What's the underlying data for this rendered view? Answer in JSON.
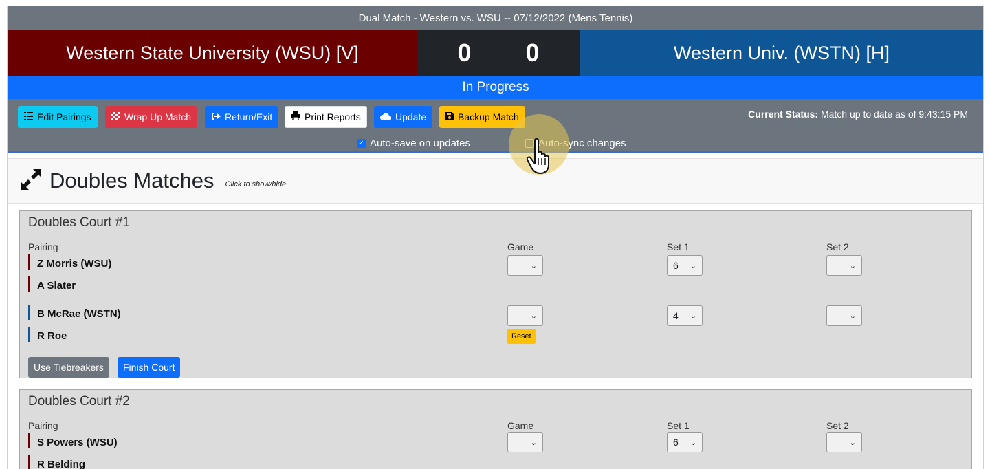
{
  "header": {
    "title": "Dual Match - Western vs. WSU -- 07/12/2022 (Mens Tennis)"
  },
  "scoreboard": {
    "away_team": "Western State University (WSU) [V]",
    "away_score": "0",
    "home_score": "0",
    "home_team": "Western Univ. (WSTN) [H]",
    "away_color": "#6a0000",
    "home_color": "#0e5696"
  },
  "status_bar": {
    "text": "In Progress"
  },
  "toolbar": {
    "buttons": [
      {
        "label": "Edit Pairings",
        "icon": "list-icon"
      },
      {
        "label": "Wrap Up Match",
        "icon": "checkered-flag-icon"
      },
      {
        "label": "Return/Exit",
        "icon": "sign-out-icon"
      },
      {
        "label": "Print Reports",
        "icon": "printer-icon"
      },
      {
        "label": "Update",
        "icon": "cloud-icon"
      },
      {
        "label": "Backup Match",
        "icon": "save-icon"
      }
    ],
    "status_label": "Current Status:",
    "status_value": "Match up to date as of 9:43:15 PM",
    "autosave_label": "Auto-save on updates",
    "autosave_checked": true,
    "autosync_label": "Auto-sync changes",
    "autosync_checked": false
  },
  "section": {
    "title": "Doubles Matches",
    "hint": "Click to show/hide",
    "icon": "expand-arrows-icon"
  },
  "courts": [
    {
      "title": "Doubles Court #1",
      "pairing_label": "Pairing",
      "game_label": "Game",
      "set1_label": "Set 1",
      "set2_label": "Set 2",
      "away_players": [
        "Z Morris (WSU)",
        "A Slater"
      ],
      "home_players": [
        "B McRae (WSTN)",
        "R Roe"
      ],
      "away_scores": {
        "game": "",
        "set1": "6",
        "set2": ""
      },
      "home_scores": {
        "game": "",
        "set1": "4",
        "set2": ""
      },
      "reset_label": "Reset",
      "tiebreak_label": "Use Tiebreakers",
      "finish_label": "Finish Court"
    },
    {
      "title": "Doubles Court #2",
      "pairing_label": "Pairing",
      "game_label": "Game",
      "set1_label": "Set 1",
      "set2_label": "Set 2",
      "away_players": [
        "S Powers (WSU)",
        "R Belding"
      ],
      "away_scores": {
        "game": "",
        "set1": "6",
        "set2": ""
      }
    }
  ]
}
